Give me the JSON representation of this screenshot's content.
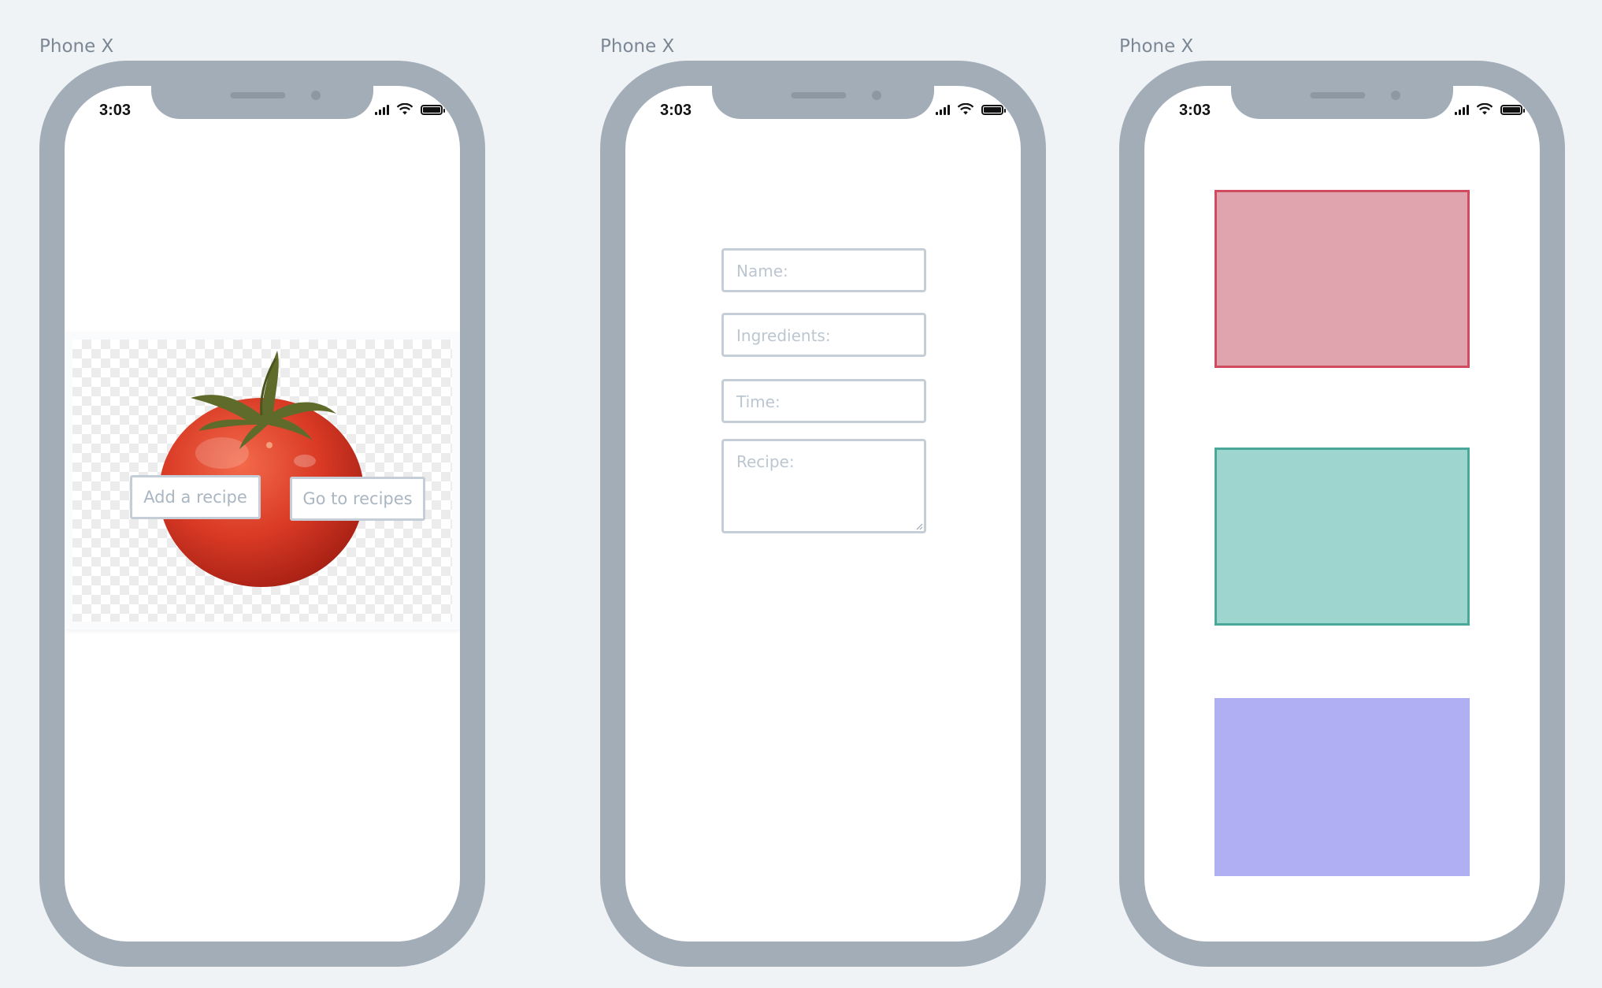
{
  "canvas": {
    "background": "#eff3f6"
  },
  "devices": [
    {
      "label": "Phone X",
      "status_bar": {
        "time": "3:03",
        "icons": [
          "signal-icon",
          "wifi-icon",
          "battery-icon"
        ]
      },
      "screen": {
        "hero_image": "tomato-photo",
        "buttons": [
          {
            "label": "Add a recipe"
          },
          {
            "label": "Go to recipes"
          }
        ]
      }
    },
    {
      "label": "Phone X",
      "status_bar": {
        "time": "3:03",
        "icons": [
          "signal-icon",
          "wifi-icon",
          "battery-icon"
        ]
      },
      "screen": {
        "fields": [
          {
            "placeholder": "Name:",
            "value": ""
          },
          {
            "placeholder": "Ingredients:",
            "value": ""
          },
          {
            "placeholder": "Time:",
            "value": ""
          },
          {
            "placeholder": "Recipe:",
            "value": ""
          }
        ]
      }
    },
    {
      "label": "Phone X",
      "status_bar": {
        "time": "3:03",
        "icons": [
          "signal-icon",
          "wifi-icon",
          "battery-icon"
        ]
      },
      "screen": {
        "cards": [
          {
            "fill": "#dfa4ae",
            "border": "#d14b5e"
          },
          {
            "fill": "#9ed6cf",
            "border": "#4aa89a"
          },
          {
            "fill": "#b0aff3",
            "border": "#b0aff3"
          }
        ]
      }
    }
  ],
  "colors": {
    "device_frame": "#a2adb8",
    "control_border": "#c5ced7",
    "placeholder_text": "#aab6c2"
  }
}
